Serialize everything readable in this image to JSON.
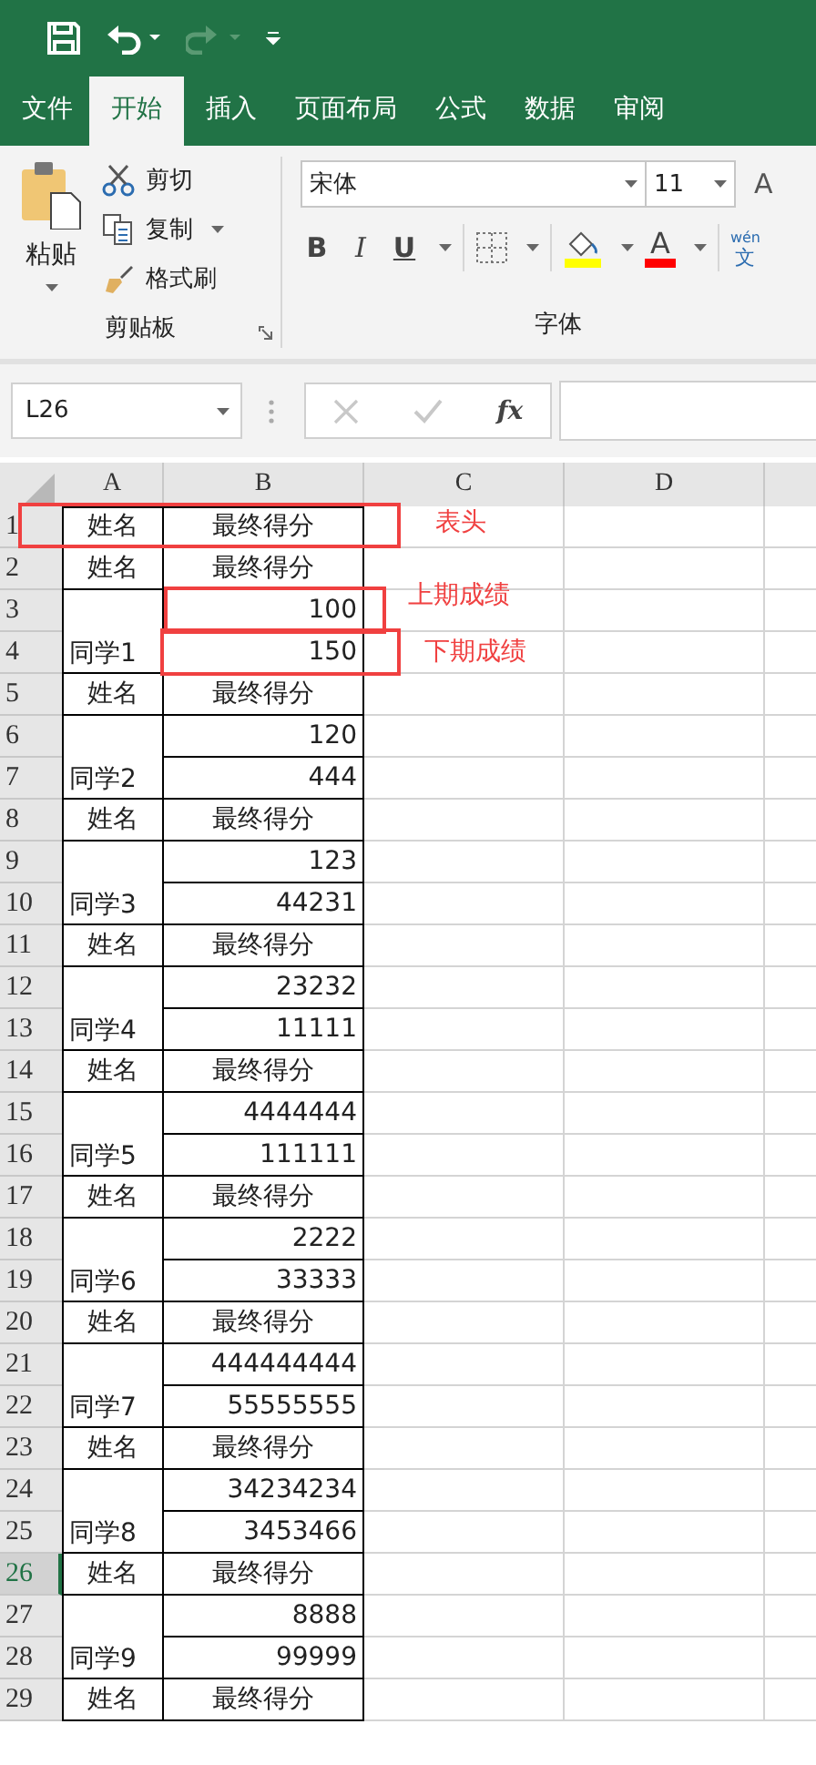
{
  "quick_access": [
    {
      "kind": "save",
      "disabled": false
    },
    {
      "kind": "undo",
      "disabled": false
    },
    {
      "kind": "redo",
      "disabled": true
    },
    {
      "kind": "customize",
      "disabled": false
    }
  ],
  "tabs": [
    {
      "label": "文件",
      "selected": false
    },
    {
      "label": "开始",
      "selected": true
    },
    {
      "label": "插入",
      "selected": false
    },
    {
      "label": "页面布局",
      "selected": false
    },
    {
      "label": "公式",
      "selected": false
    },
    {
      "label": "数据",
      "selected": false
    },
    {
      "label": "审阅",
      "selected": false
    }
  ],
  "clipboard": {
    "paste": "粘贴",
    "cut": "剪切",
    "copy": "复制",
    "format_painter": "格式刷",
    "group_label": "剪贴板"
  },
  "font": {
    "name": "宋体",
    "size": "11",
    "grow": "A",
    "bold": "B",
    "italic": "I",
    "underline": "U",
    "font_color_letter": "A",
    "phonetic_top": "wén",
    "phonetic_bottom": "文",
    "group_label": "字体"
  },
  "formula_bar": {
    "name_box": "L26",
    "function_label": "fx"
  },
  "columns": [
    "A",
    "B",
    "C",
    "D"
  ],
  "rows": [
    {
      "number": "1",
      "kind": "header",
      "a": "姓名",
      "b": "最终得分",
      "selected": false
    },
    {
      "number": "2",
      "kind": "header",
      "a": "姓名",
      "b": "最终得分",
      "selected": false
    },
    {
      "number": "3",
      "kind": "score_top",
      "b": "100",
      "selected": false
    },
    {
      "number": "4",
      "kind": "score_bottom",
      "a": "同学1",
      "b": "150",
      "selected": false
    },
    {
      "number": "5",
      "kind": "header",
      "a": "姓名",
      "b": "最终得分",
      "selected": false
    },
    {
      "number": "6",
      "kind": "score_top",
      "b": "120",
      "selected": false
    },
    {
      "number": "7",
      "kind": "score_bottom",
      "a": "同学2",
      "b": "444",
      "selected": false
    },
    {
      "number": "8",
      "kind": "header",
      "a": "姓名",
      "b": "最终得分",
      "selected": false
    },
    {
      "number": "9",
      "kind": "score_top",
      "b": "123",
      "selected": false
    },
    {
      "number": "10",
      "kind": "score_bottom",
      "a": "同学3",
      "b": "44231",
      "selected": false
    },
    {
      "number": "11",
      "kind": "header",
      "a": "姓名",
      "b": "最终得分",
      "selected": false
    },
    {
      "number": "12",
      "kind": "score_top",
      "b": "23232",
      "selected": false
    },
    {
      "number": "13",
      "kind": "score_bottom",
      "a": "同学4",
      "b": "11111",
      "selected": false
    },
    {
      "number": "14",
      "kind": "header",
      "a": "姓名",
      "b": "最终得分",
      "selected": false
    },
    {
      "number": "15",
      "kind": "score_top",
      "b": "4444444",
      "selected": false
    },
    {
      "number": "16",
      "kind": "score_bottom",
      "a": "同学5",
      "b": "111111",
      "selected": false
    },
    {
      "number": "17",
      "kind": "header",
      "a": "姓名",
      "b": "最终得分",
      "selected": false
    },
    {
      "number": "18",
      "kind": "score_top",
      "b": "2222",
      "selected": false
    },
    {
      "number": "19",
      "kind": "score_bottom",
      "a": "同学6",
      "b": "33333",
      "selected": false
    },
    {
      "number": "20",
      "kind": "header",
      "a": "姓名",
      "b": "最终得分",
      "selected": false
    },
    {
      "number": "21",
      "kind": "score_top",
      "b": "444444444",
      "selected": false
    },
    {
      "number": "22",
      "kind": "score_bottom",
      "a": "同学7",
      "b": "55555555",
      "selected": false
    },
    {
      "number": "23",
      "kind": "header",
      "a": "姓名",
      "b": "最终得分",
      "selected": false
    },
    {
      "number": "24",
      "kind": "score_top",
      "b": "34234234",
      "selected": false
    },
    {
      "number": "25",
      "kind": "score_bottom",
      "a": "同学8",
      "b": "3453466",
      "selected": false
    },
    {
      "number": "26",
      "kind": "header",
      "a": "姓名",
      "b": "最终得分",
      "selected": true
    },
    {
      "number": "27",
      "kind": "score_top",
      "b": "8888",
      "selected": false
    },
    {
      "number": "28",
      "kind": "score_bottom",
      "a": "同学9",
      "b": "99999",
      "selected": false
    },
    {
      "number": "29",
      "kind": "header",
      "a": "姓名",
      "b": "最终得分",
      "selected": false
    }
  ],
  "annotations": [
    {
      "label": "表头"
    },
    {
      "label": "上期成绩"
    },
    {
      "label": "下期成绩"
    }
  ]
}
